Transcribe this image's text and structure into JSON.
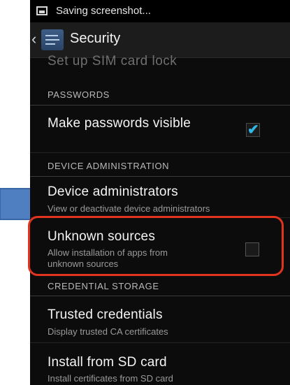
{
  "status_bar": {
    "text": "Saving screenshot..."
  },
  "action_bar": {
    "back": "‹",
    "title": "Security"
  },
  "faded_item": "Set up SIM card lock",
  "sections": {
    "passwords": "PASSWORDS",
    "device_administration": "DEVICE ADMINISTRATION",
    "credential_storage": "CREDENTIAL STORAGE"
  },
  "items": {
    "make_passwords_visible": {
      "title": "Make passwords visible",
      "checked": true
    },
    "device_administrators": {
      "title": "Device administrators",
      "subtitle": "View or deactivate device administrators"
    },
    "unknown_sources": {
      "title": "Unknown sources",
      "subtitle_line1": "Allow installation of apps from",
      "subtitle_line2": "unknown sources",
      "checked": false
    },
    "trusted_credentials": {
      "title": "Trusted credentials",
      "subtitle": "Display trusted CA certificates"
    },
    "install_from_sd": {
      "title": "Install from SD card",
      "subtitle": "Install certificates from SD card"
    }
  },
  "colors": {
    "accent": "#33b5e5",
    "highlight_border": "#e0341f",
    "arrow": "#4f7fc0"
  },
  "icons": [
    "image-icon",
    "back-icon",
    "settings-icon",
    "check-icon",
    "pointer-arrow"
  ]
}
